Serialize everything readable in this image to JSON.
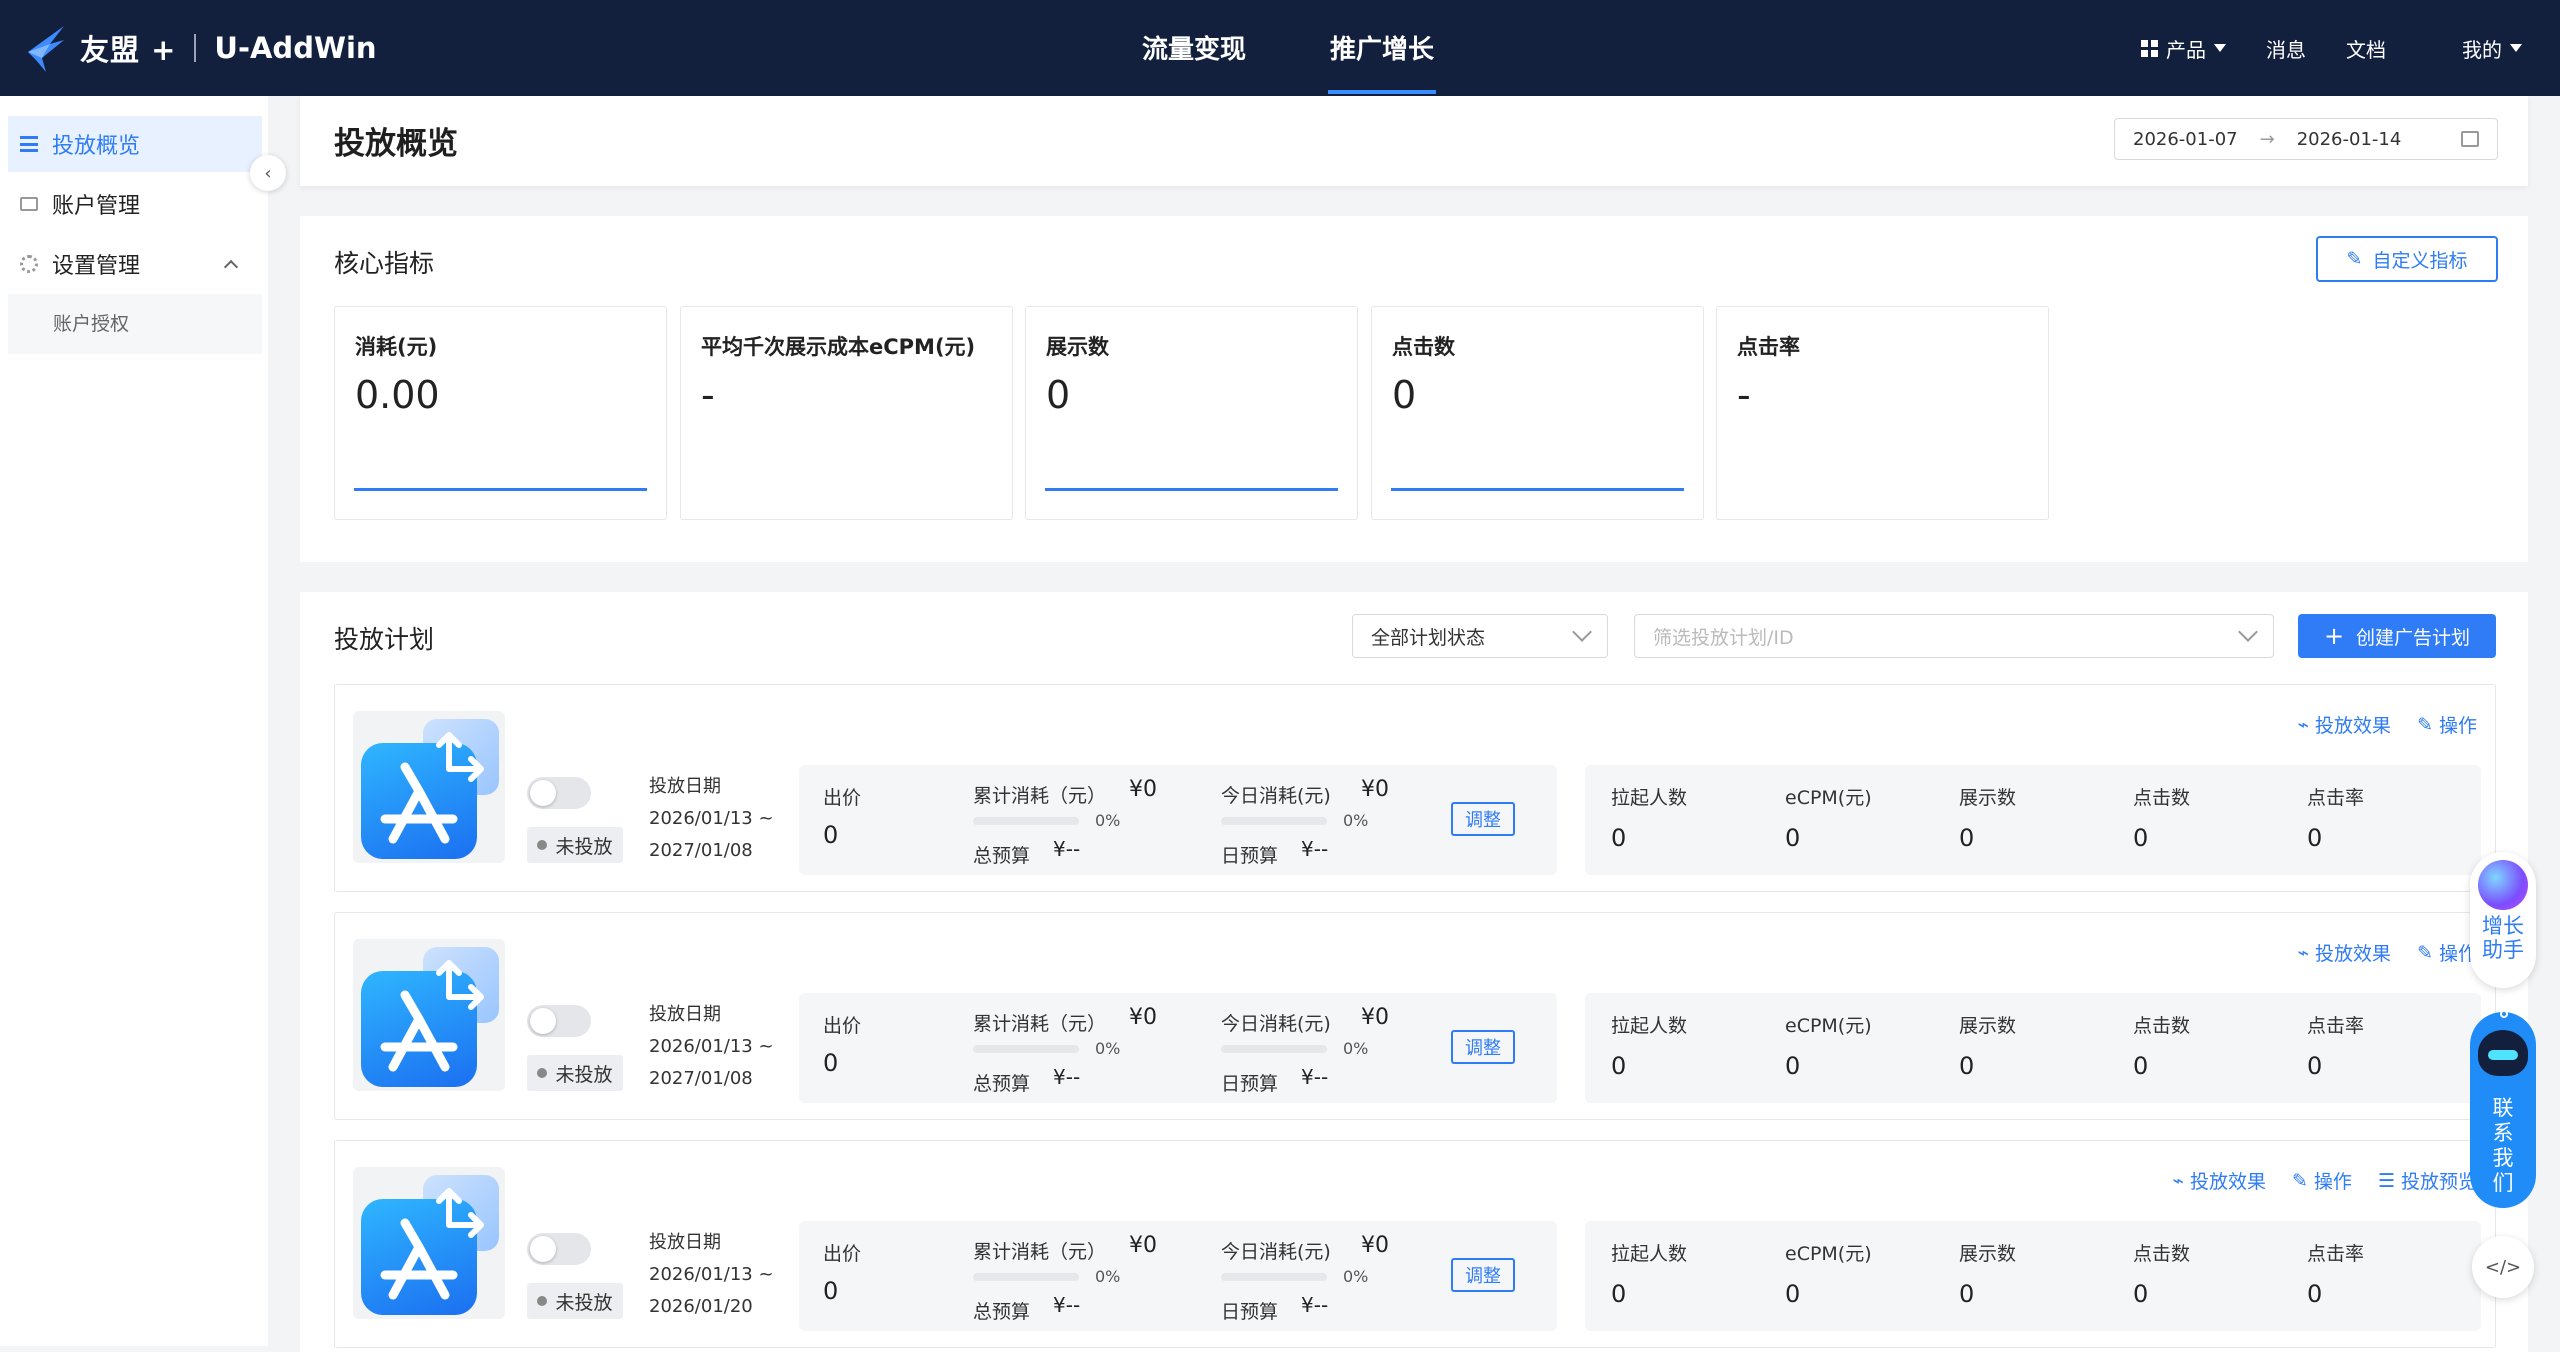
{
  "header": {
    "brand": "友盟 +",
    "product": "U-AddWin",
    "nav": [
      {
        "label": "流量变现",
        "active": false
      },
      {
        "label": "推广增长",
        "active": true
      }
    ],
    "products_label": "产品",
    "messages_label": "消息",
    "docs_label": "文档",
    "mine_label": "我的"
  },
  "sidebar": {
    "items": [
      {
        "label": "投放概览",
        "active": true,
        "icon": "list-icon"
      },
      {
        "label": "账户管理",
        "active": false,
        "icon": "account-icon"
      },
      {
        "label": "设置管理",
        "active": false,
        "icon": "gear-icon"
      }
    ],
    "sub_items": [
      {
        "label": "账户授权"
      }
    ]
  },
  "page": {
    "title": "投放概览",
    "date_start": "2026-01-07",
    "date_end": "2026-01-14"
  },
  "core": {
    "title": "核心指标",
    "custom_button": "自定义指标",
    "metrics": [
      {
        "label": "消耗(元)",
        "value": "0.00",
        "has_line": true
      },
      {
        "label": "平均千次展示成本eCPM(元)",
        "value": "-",
        "has_line": false
      },
      {
        "label": "展示数",
        "value": "0",
        "has_line": true
      },
      {
        "label": "点击数",
        "value": "0",
        "has_line": true
      },
      {
        "label": "点击率",
        "value": "-",
        "has_line": false
      }
    ]
  },
  "plans": {
    "title": "投放计划",
    "status_filter": "全部计划状态",
    "search_placeholder": "筛选投放计划/ID",
    "create_button": "创建广告计划",
    "labels": {
      "date": "投放日期",
      "bid": "出价",
      "total_spend": "累计消耗（元）",
      "today_spend": "今日消耗(元)",
      "total_budget": "总预算",
      "daily_budget": "日预算",
      "adjust": "调整",
      "launches": "拉起人数",
      "ecpm": "eCPM(元)",
      "impressions": "展示数",
      "clicks": "点击数",
      "ctr": "点击率"
    },
    "rows": [
      {
        "status": "未投放",
        "date_start": "2026/01/13 ~",
        "date_end": "2027/01/08",
        "bid": "0",
        "total_spend": "¥0",
        "total_pct": "0%",
        "total_budget": "¥--",
        "today_spend": "¥0",
        "today_pct": "0%",
        "daily_budget": "¥--",
        "launches": "0",
        "ecpm": "0",
        "impressions": "0",
        "clicks": "0",
        "ctr": "0",
        "actions": [
          "投放效果",
          "操作"
        ]
      },
      {
        "status": "未投放",
        "date_start": "2026/01/13 ~",
        "date_end": "2027/01/08",
        "bid": "0",
        "total_spend": "¥0",
        "total_pct": "0%",
        "total_budget": "¥--",
        "today_spend": "¥0",
        "today_pct": "0%",
        "daily_budget": "¥--",
        "launches": "0",
        "ecpm": "0",
        "impressions": "0",
        "clicks": "0",
        "ctr": "0",
        "actions": [
          "投放效果",
          "操作"
        ]
      },
      {
        "status": "未投放",
        "date_start": "2026/01/13 ~",
        "date_end": "2026/01/20",
        "bid": "0",
        "total_spend": "¥0",
        "total_pct": "0%",
        "total_budget": "¥--",
        "today_spend": "¥0",
        "today_pct": "0%",
        "daily_budget": "¥--",
        "launches": "0",
        "ecpm": "0",
        "impressions": "0",
        "clicks": "0",
        "ctr": "0",
        "actions": [
          "投放效果",
          "操作",
          "投放预览"
        ]
      }
    ]
  },
  "floating": {
    "helper_label": "增长助手",
    "contact_label": "联系我们"
  }
}
